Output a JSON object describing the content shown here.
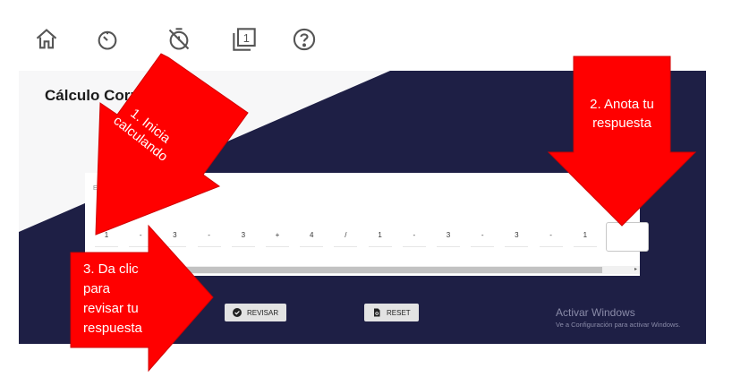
{
  "toolbar": {
    "icons": [
      "home-icon",
      "timer-icon",
      "timer-off-icon",
      "counter-icon",
      "help-icon"
    ],
    "counter_value": "1"
  },
  "card": {
    "title": "Cálculo Corri",
    "input_placeholder": "Escr",
    "expression": [
      "1",
      "-",
      "3",
      "-",
      "3",
      "+",
      "4",
      "/",
      "1",
      "-",
      "3",
      "-",
      "3",
      "-",
      "1"
    ],
    "answer": ""
  },
  "buttons": {
    "check_label": "REVISAR",
    "reset_label": "RESET"
  },
  "watermark": {
    "title": "Activar Windows",
    "subtitle": "Ve a Configuración para activar Windows."
  },
  "annotations": {
    "step1": [
      "1. Inicia",
      "calculando"
    ],
    "step2": [
      "2. Anota tu",
      "respuesta"
    ],
    "step3": [
      "3. Da clic",
      "para",
      "revisar tu",
      "respuesta"
    ]
  },
  "colors": {
    "panel": "#1e1f45",
    "arrow": "#ff0000",
    "icons": "#555555"
  }
}
